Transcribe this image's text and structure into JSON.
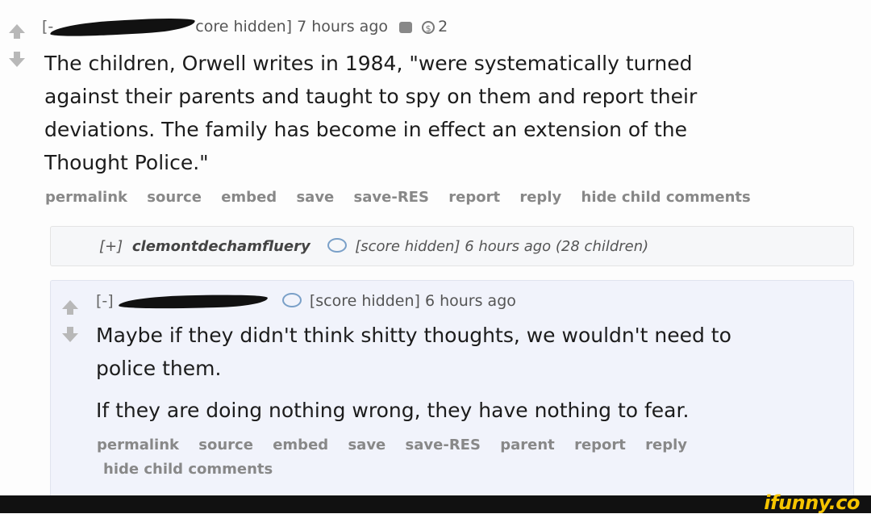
{
  "parent": {
    "toggle": "[-",
    "tagline": "core hidden] 7 hours ago",
    "coin_count": "2",
    "body": [
      "The children, Orwell writes in 1984, \"were systematically turned",
      "against their parents and taught to spy on them and report their",
      "deviations. The family has become in effect an extension of the",
      "Thought Police.\""
    ],
    "buttons": [
      "permalink",
      "source",
      "embed",
      "save",
      "save-RES",
      "report",
      "reply",
      "hide child comments"
    ]
  },
  "collapsed": {
    "toggle": "[+]",
    "author": "clemontdechamfluery",
    "tagline": "[score hidden] 6 hours ago (28 children)"
  },
  "reply": {
    "toggle": "[-]",
    "tagline": "[score hidden] 6 hours ago",
    "body": [
      "Maybe if they didn't think shitty thoughts, we wouldn't need to",
      "police them."
    ],
    "body2": "If they are doing nothing wrong, they have nothing to fear.",
    "buttons_line1": [
      "permalink",
      "source",
      "embed",
      "save",
      "save-RES",
      "parent",
      "report",
      "reply"
    ],
    "buttons_line2": "hide child comments"
  },
  "watermark": "ifunny.co"
}
